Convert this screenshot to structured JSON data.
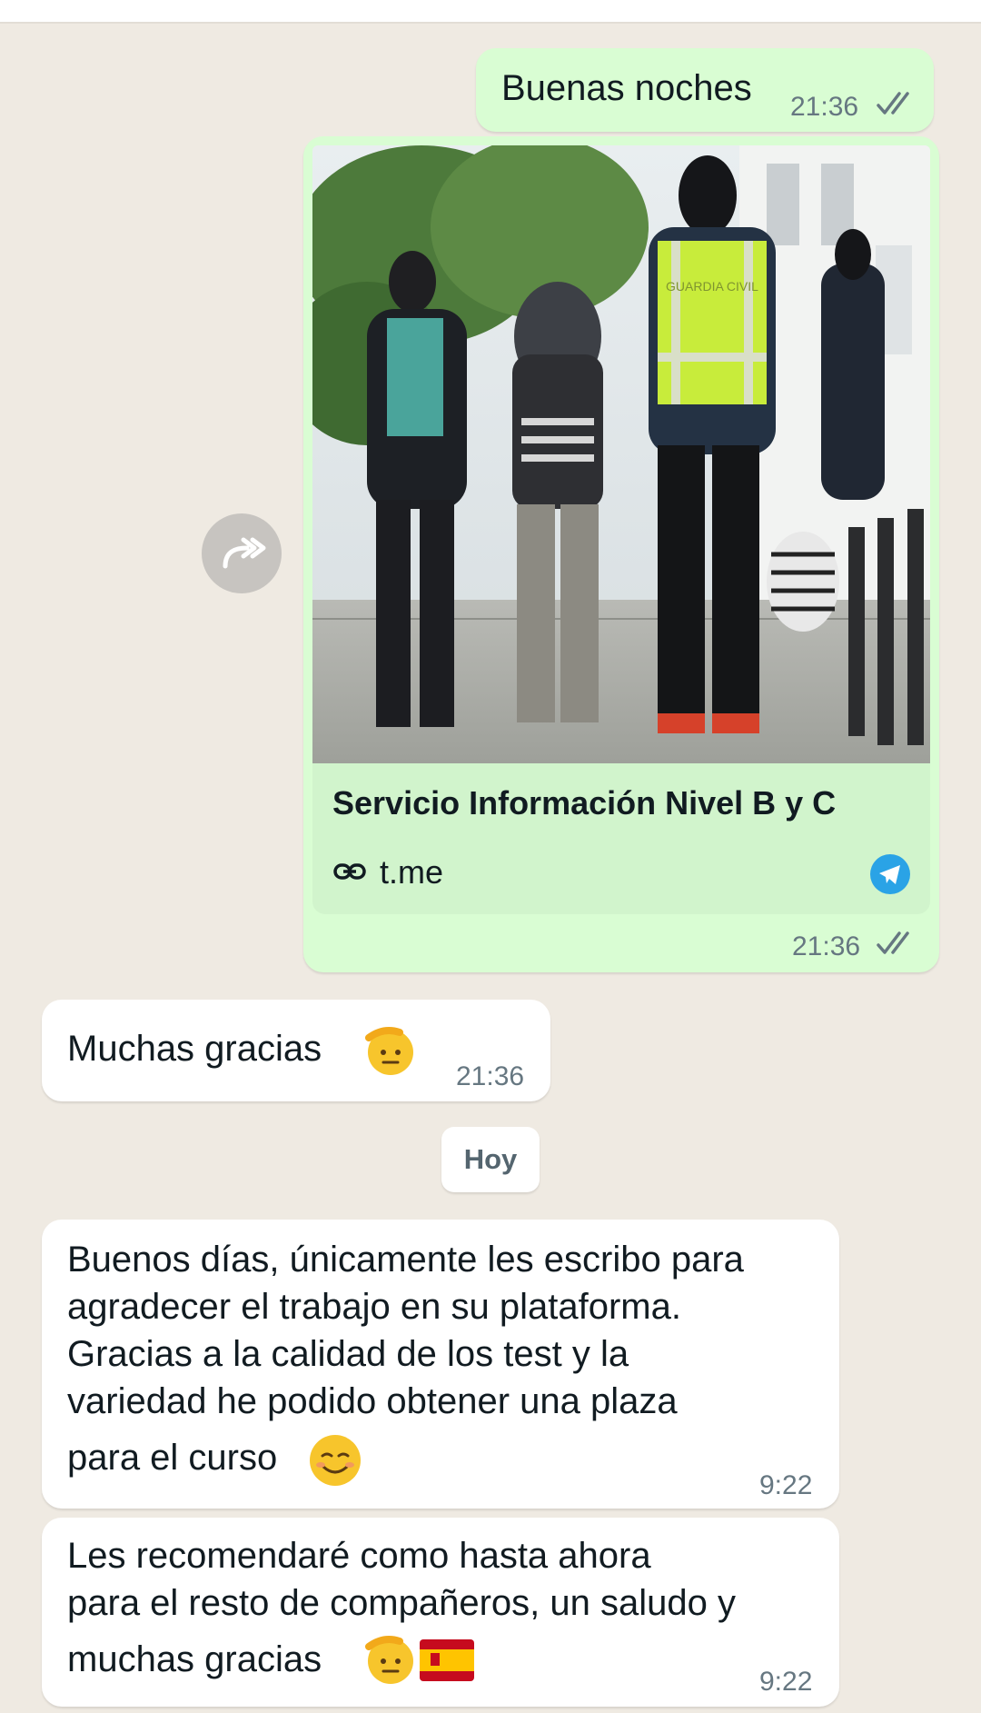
{
  "messages": {
    "m1": {
      "text": "Buenas noches",
      "time": "21:36"
    },
    "m2": {
      "link_title": "Servicio Información Nivel B y C",
      "link_domain": "t.me",
      "time": "21:36",
      "image_alt": "Guardia Civil agents escorting a detained person"
    },
    "m3": {
      "text": "Muchas gracias",
      "time": "21:36"
    },
    "date_separator": "Hoy",
    "m4": {
      "lines": [
        "Buenos días, únicamente les escribo para",
        "agradecer el trabajo en su plataforma.",
        "Gracias a la calidad de los test y la",
        "variedad he podido obtener una plaza",
        "para el curso"
      ],
      "time": "9:22"
    },
    "m5": {
      "lines": [
        "Les recomendaré como hasta ahora",
        "para el resto de compañeros, un saludo y",
        "muchas gracias"
      ],
      "time": "9:22"
    }
  },
  "photo_vest_text": "GUARDIA CIVIL",
  "colors": {
    "chat_bg": "#efeae2",
    "outgoing": "#d9fdd3",
    "incoming": "#ffffff",
    "read_ticks": "#667781",
    "telegram": "#2aa3e6"
  },
  "icons": [
    "forward-icon",
    "double-check-icon",
    "link-icon",
    "telegram-icon",
    "saluting-face-emoji",
    "smiling-face-emoji",
    "spain-flag-emoji"
  ]
}
